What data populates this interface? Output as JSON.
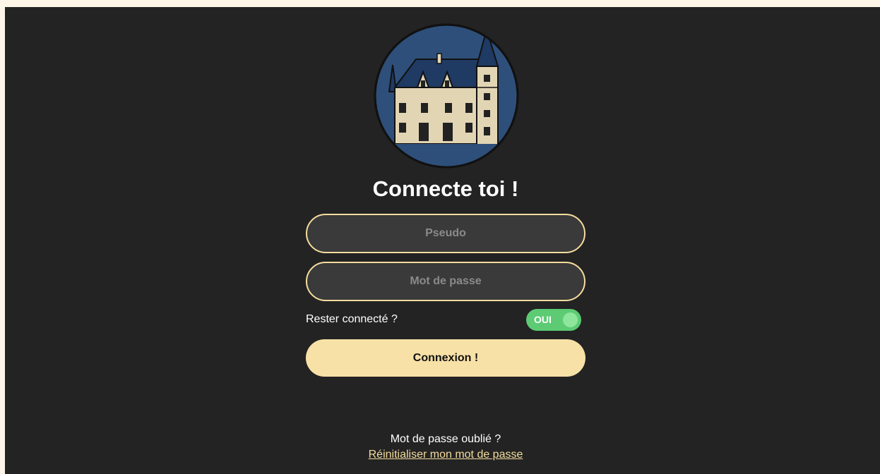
{
  "login": {
    "title": "Connecte toi !",
    "username_placeholder": "Pseudo",
    "password_placeholder": "Mot de passe",
    "remember_label": "Rester connecté ?",
    "remember_toggle_text": "OUI",
    "remember_on": true,
    "submit_label": "Connexion !",
    "forgot_text": "Mot de passe oublié ?",
    "reset_link_text": "Réinitialiser mon mot de passe"
  },
  "colors": {
    "background": "#232323",
    "accent": "#f8e1a6",
    "field_border": "#f5dc9e",
    "toggle_on": "#5ccb74",
    "logo_circle": "#2e4f7a"
  },
  "icons": {
    "logo": "castle-logo-icon"
  }
}
